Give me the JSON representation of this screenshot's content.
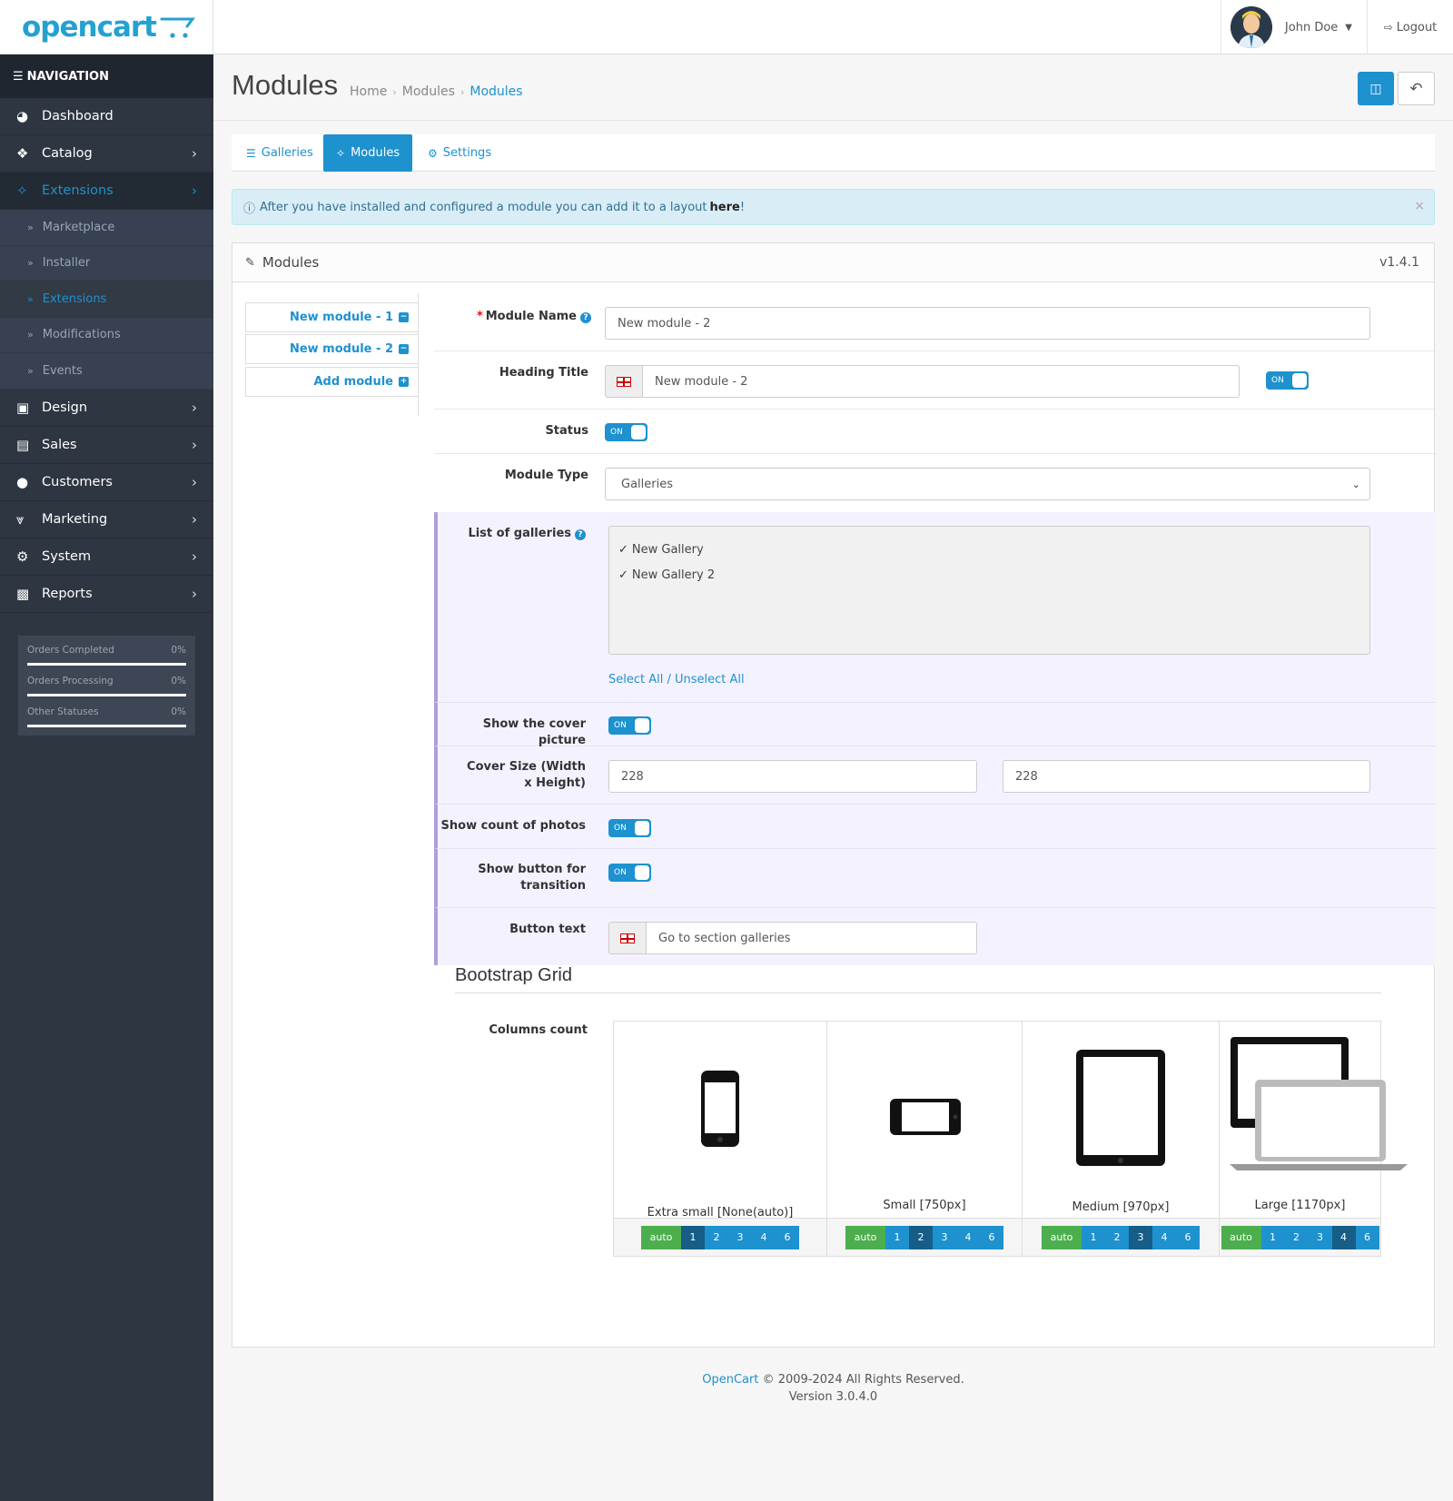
{
  "header": {
    "logo_text": "opencart",
    "user_name": "John Doe",
    "logout_label": "Logout"
  },
  "sidebar": {
    "nav_heading": "NAVIGATION",
    "items": [
      {
        "label": "Dashboard",
        "icon": "dashboard-icon"
      },
      {
        "label": "Catalog",
        "icon": "tag-icon"
      },
      {
        "label": "Extensions",
        "icon": "puzzle-icon"
      },
      {
        "label": "Design",
        "icon": "monitor-icon"
      },
      {
        "label": "Sales",
        "icon": "cart-icon"
      },
      {
        "label": "Customers",
        "icon": "user-icon"
      },
      {
        "label": "Marketing",
        "icon": "share-icon"
      },
      {
        "label": "System",
        "icon": "gear-icon"
      },
      {
        "label": "Reports",
        "icon": "bar-chart-icon"
      }
    ],
    "subitems": [
      "Marketplace",
      "Installer",
      "Extensions",
      "Modifications",
      "Events"
    ],
    "stats": [
      {
        "label": "Orders Completed",
        "value": "0%"
      },
      {
        "label": "Orders Processing",
        "value": "0%"
      },
      {
        "label": "Other Statuses",
        "value": "0%"
      }
    ]
  },
  "page": {
    "title": "Modules",
    "breadcrumbs": [
      "Home",
      "Modules",
      "Modules"
    ]
  },
  "tabs": [
    "Galleries",
    "Modules",
    "Settings"
  ],
  "alert": {
    "text": "After you have installed and configured a module you can add it to a layout",
    "link": "here",
    "suffix": "!"
  },
  "panel": {
    "title": "Modules",
    "version": "v1.4.1",
    "module_tabs": [
      "New module - 1",
      "New module - 2",
      "Add module"
    ]
  },
  "form": {
    "module_name_label": "Module Name",
    "module_name_value": "New module - 2",
    "heading_title_label": "Heading Title",
    "heading_title_value": "New module - 2",
    "heading_toggle": "ON",
    "status_label": "Status",
    "status_toggle": "ON",
    "module_type_label": "Module Type",
    "module_type_value": "Galleries",
    "galleries_label": "List of galleries",
    "galleries": [
      "New Gallery",
      "New Gallery 2"
    ],
    "select_all": "Select All",
    "slash": " / ",
    "unselect_all": "Unselect All",
    "cover_label": "Show the cover picture",
    "cover_toggle": "ON",
    "cover_size_label": "Cover Size (Width x Height)",
    "cover_width": "228",
    "cover_height": "228",
    "count_label": "Show count of photos",
    "count_toggle": "ON",
    "transition_label": "Show button for transition",
    "transition_toggle": "ON",
    "button_text_label": "Button text",
    "button_text_value": "Go to section galleries"
  },
  "grid": {
    "title": "Bootstrap Grid",
    "columns_label": "Columns count",
    "devices": [
      {
        "caption": "Extra small [None(auto)]",
        "selected": "1"
      },
      {
        "caption": "Small [750px]",
        "selected": "2"
      },
      {
        "caption": "Medium [970px]",
        "selected": "3"
      },
      {
        "caption": "Large [1170px]",
        "selected": "4"
      }
    ],
    "options": [
      "auto",
      "1",
      "2",
      "3",
      "4",
      "6"
    ]
  },
  "footer": {
    "brand": "OpenCart",
    "copyright": " © 2009-2024 All Rights Reserved.",
    "version": "Version 3.0.4.0"
  },
  "colors": {
    "accent": "#1e91cf",
    "sidebar": "#2e3641",
    "success": "#4cae4c",
    "highlight_bg": "#f5f2ff"
  }
}
